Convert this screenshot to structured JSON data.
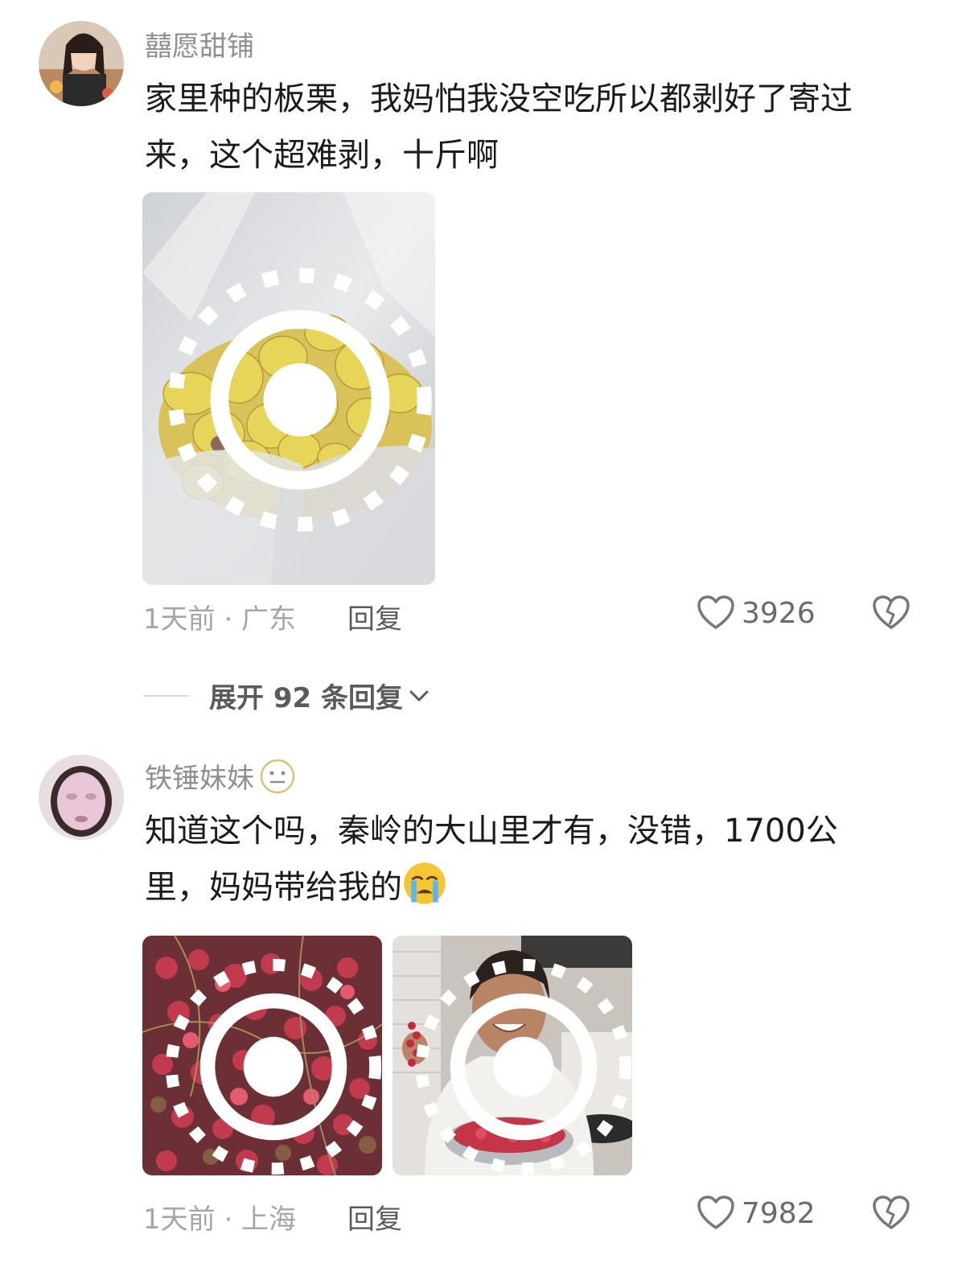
{
  "comments": [
    {
      "username": "囍愿甜铺",
      "text_lines": [
        "家里种的板栗，我妈怕我没空吃所以都剥好了寄过",
        "来，这个超难剥，十斤啊"
      ],
      "time_location": "1天前 · 广东",
      "reply_label": "回复",
      "likes": "3926",
      "images": [
        "peeled-chestnuts-photo"
      ]
    },
    {
      "username": "铁锤妹妹",
      "username_emoji": "neutral-face-emoji",
      "text_lines": [
        "知道这个吗，秦岭的大山里才有，没错，1700公",
        "里，妈妈带给我的"
      ],
      "text_emoji": "crying-face-emoji",
      "time_location": "1天前 · 上海",
      "reply_label": "回复",
      "likes": "7982",
      "images": [
        "schisandra-berries-photo",
        "mother-holding-berries-photo"
      ]
    }
  ],
  "expand_replies": {
    "label": "展开 92 条回复"
  },
  "icons": {
    "like": "heart-outline-icon",
    "dislike": "broken-heart-icon",
    "live": "live-photo-icon",
    "expand": "chevron-down-icon"
  },
  "colors": {
    "username": "#8f8f8f",
    "body_text": "#1b1b1b",
    "meta": "#a6a6a6"
  }
}
